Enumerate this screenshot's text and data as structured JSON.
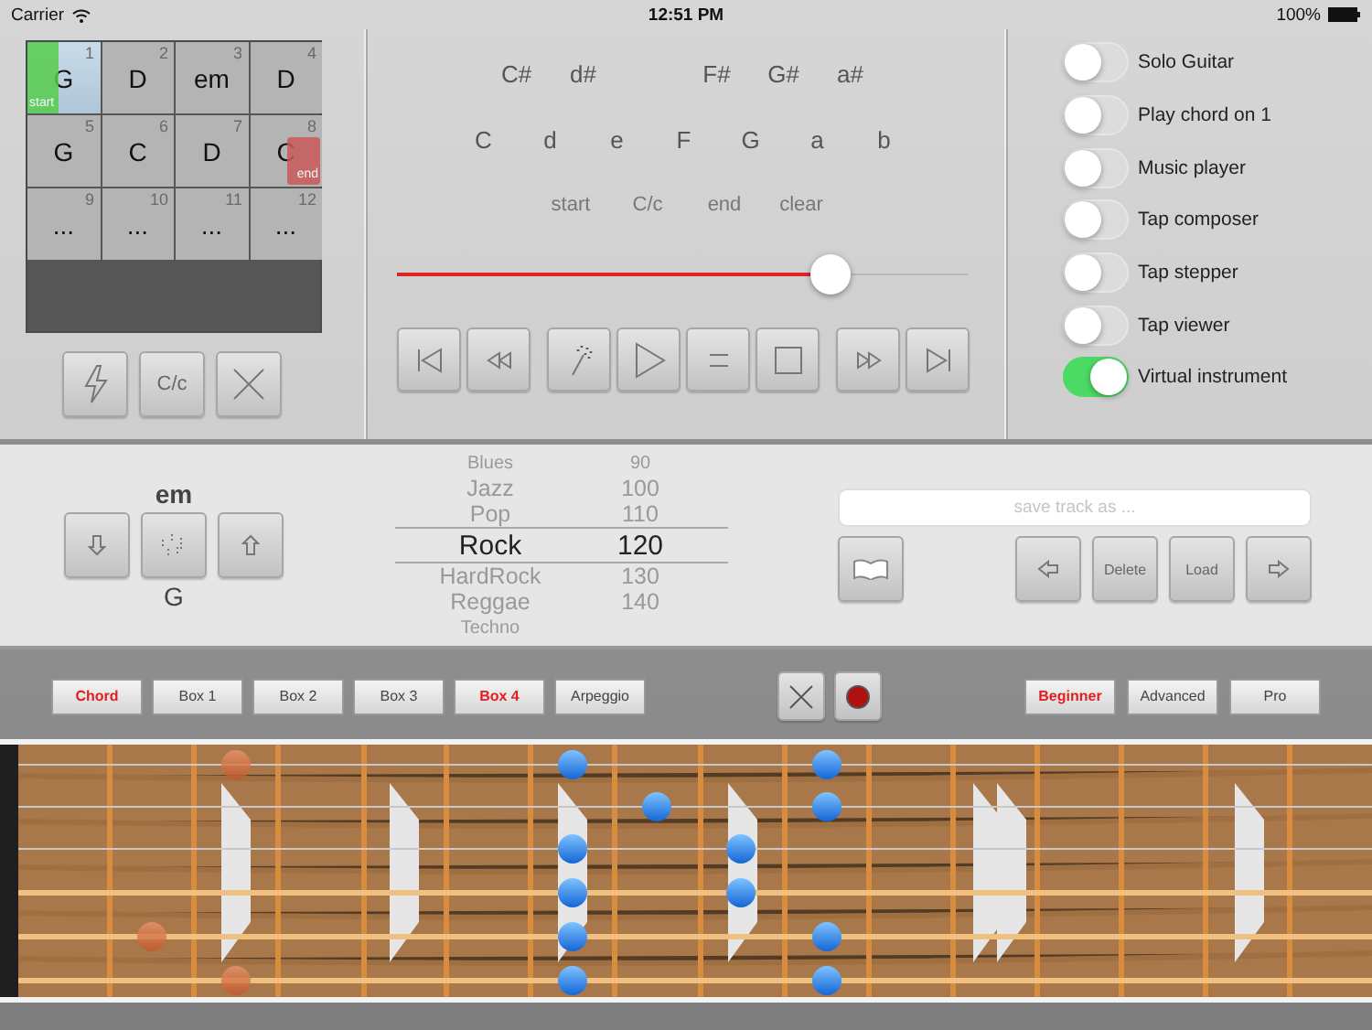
{
  "status_bar": {
    "carrier": "Carrier",
    "time": "12:51 PM",
    "battery": "100%"
  },
  "chord_grid": {
    "cells": [
      {
        "number": "1",
        "chord": "G",
        "selected": true,
        "marker": {
          "kind": "start",
          "label": "start"
        }
      },
      {
        "number": "2",
        "chord": "D",
        "selected": false
      },
      {
        "number": "3",
        "chord": "em",
        "selected": false
      },
      {
        "number": "4",
        "chord": "D",
        "selected": false
      },
      {
        "number": "5",
        "chord": "G",
        "selected": false
      },
      {
        "number": "6",
        "chord": "C",
        "selected": false
      },
      {
        "number": "7",
        "chord": "D",
        "selected": false
      },
      {
        "number": "8",
        "chord": "C",
        "selected": false,
        "marker": {
          "kind": "end",
          "label": "end"
        }
      },
      {
        "number": "9",
        "chord": "...",
        "selected": false
      },
      {
        "number": "10",
        "chord": "...",
        "selected": false
      },
      {
        "number": "11",
        "chord": "...",
        "selected": false
      },
      {
        "number": "12",
        "chord": "...",
        "selected": false
      }
    ]
  },
  "case_button": "C/c",
  "notes": {
    "sharp_groups": [
      [
        "C#",
        "d#"
      ],
      [
        "F#",
        "G#",
        "a#"
      ]
    ],
    "naturals": [
      "C",
      "d",
      "e",
      "F",
      "G",
      "a",
      "b"
    ],
    "markers": [
      "start",
      "C/c",
      "end",
      "clear"
    ]
  },
  "position_slider": {
    "level": 0.76
  },
  "toggles": [
    {
      "label": "Solo Guitar",
      "on": false
    },
    {
      "label": "Play chord on 1",
      "on": false
    },
    {
      "label": "Music player",
      "on": false
    },
    {
      "label": "Tap composer",
      "on": false
    },
    {
      "label": "Tap stepper",
      "on": false
    },
    {
      "label": "Tap viewer",
      "on": false
    },
    {
      "label": "Virtual instrument",
      "on": true
    }
  ],
  "chord_stepper": {
    "above": "em",
    "below": "G"
  },
  "style_picker": {
    "rows": [
      {
        "genre": "Blues",
        "tempo": "90",
        "selected": false
      },
      {
        "genre": "Jazz",
        "tempo": "100",
        "selected": false
      },
      {
        "genre": "Pop",
        "tempo": "110",
        "selected": false
      },
      {
        "genre": "Rock",
        "tempo": "120",
        "selected": true
      },
      {
        "genre": "HardRock",
        "tempo": "130",
        "selected": false
      },
      {
        "genre": "Reggae",
        "tempo": "140",
        "selected": false
      },
      {
        "genre": "Techno",
        "selected": false
      }
    ]
  },
  "save_field": {
    "placeholder": "save track as ..."
  },
  "track_buttons": [
    "Delete",
    "Load"
  ],
  "pattern_tabs": [
    {
      "label": "Chord",
      "selected": true
    },
    {
      "label": "Box 1",
      "selected": false
    },
    {
      "label": "Box 2",
      "selected": false
    },
    {
      "label": "Box 3",
      "selected": false
    },
    {
      "label": "Box 4",
      "selected": true
    },
    {
      "label": "Arpeggio",
      "selected": false
    }
  ],
  "level_tabs": [
    {
      "label": "Beginner",
      "selected": true
    },
    {
      "label": "Advanced",
      "selected": false
    },
    {
      "label": "Pro",
      "selected": false
    }
  ]
}
